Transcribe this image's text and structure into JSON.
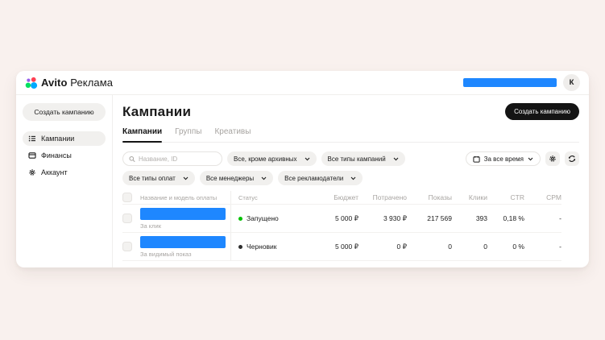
{
  "colors": {
    "redaction_bar": "#1e87ff",
    "status_running": "#00c200",
    "status_draft": "#2e2e2e"
  },
  "topbar": {
    "logo_bold": "Avito",
    "logo_regular": "Реклама",
    "avatar_initial": "К"
  },
  "sidebar": {
    "create_button": "Создать кампанию",
    "items": [
      {
        "label": "Кампании",
        "icon": "list-icon",
        "active": true
      },
      {
        "label": "Финансы",
        "icon": "card-icon",
        "active": false
      },
      {
        "label": "Аккаунт",
        "icon": "gear-icon",
        "active": false
      }
    ]
  },
  "main": {
    "title": "Кампании",
    "create_button": "Создать кампанию",
    "tabs": [
      {
        "label": "Кампании",
        "active": true
      },
      {
        "label": "Группы",
        "active": false
      },
      {
        "label": "Креативы",
        "active": false
      }
    ],
    "filters": {
      "search_placeholder": "Название, ID",
      "archive": "Все, кроме архивных",
      "campaign_types": "Все типы кампаний",
      "period": "За все время",
      "payment_types": "Все типы оплат",
      "managers": "Все менеджеры",
      "advertisers": "Все рекламодатели"
    },
    "table": {
      "columns": [
        "Название и модель оплаты",
        "Статус",
        "Бюджет",
        "Потрачено",
        "Показы",
        "Клики",
        "CTR",
        "CPM"
      ],
      "rows": [
        {
          "payment_model": "За клик",
          "status": "Запущено",
          "status_color": "#00c200",
          "budget": "5 000 ₽",
          "spent": "3 930 ₽",
          "impressions": "217 569",
          "clicks": "393",
          "ctr": "0,18 %",
          "cpm": "-"
        },
        {
          "payment_model": "За видимый показ",
          "status": "Черновик",
          "status_color": "#2e2e2e",
          "budget": "5 000 ₽",
          "spent": "0 ₽",
          "impressions": "0",
          "clicks": "0",
          "ctr": "0 %",
          "cpm": "-"
        }
      ]
    }
  }
}
